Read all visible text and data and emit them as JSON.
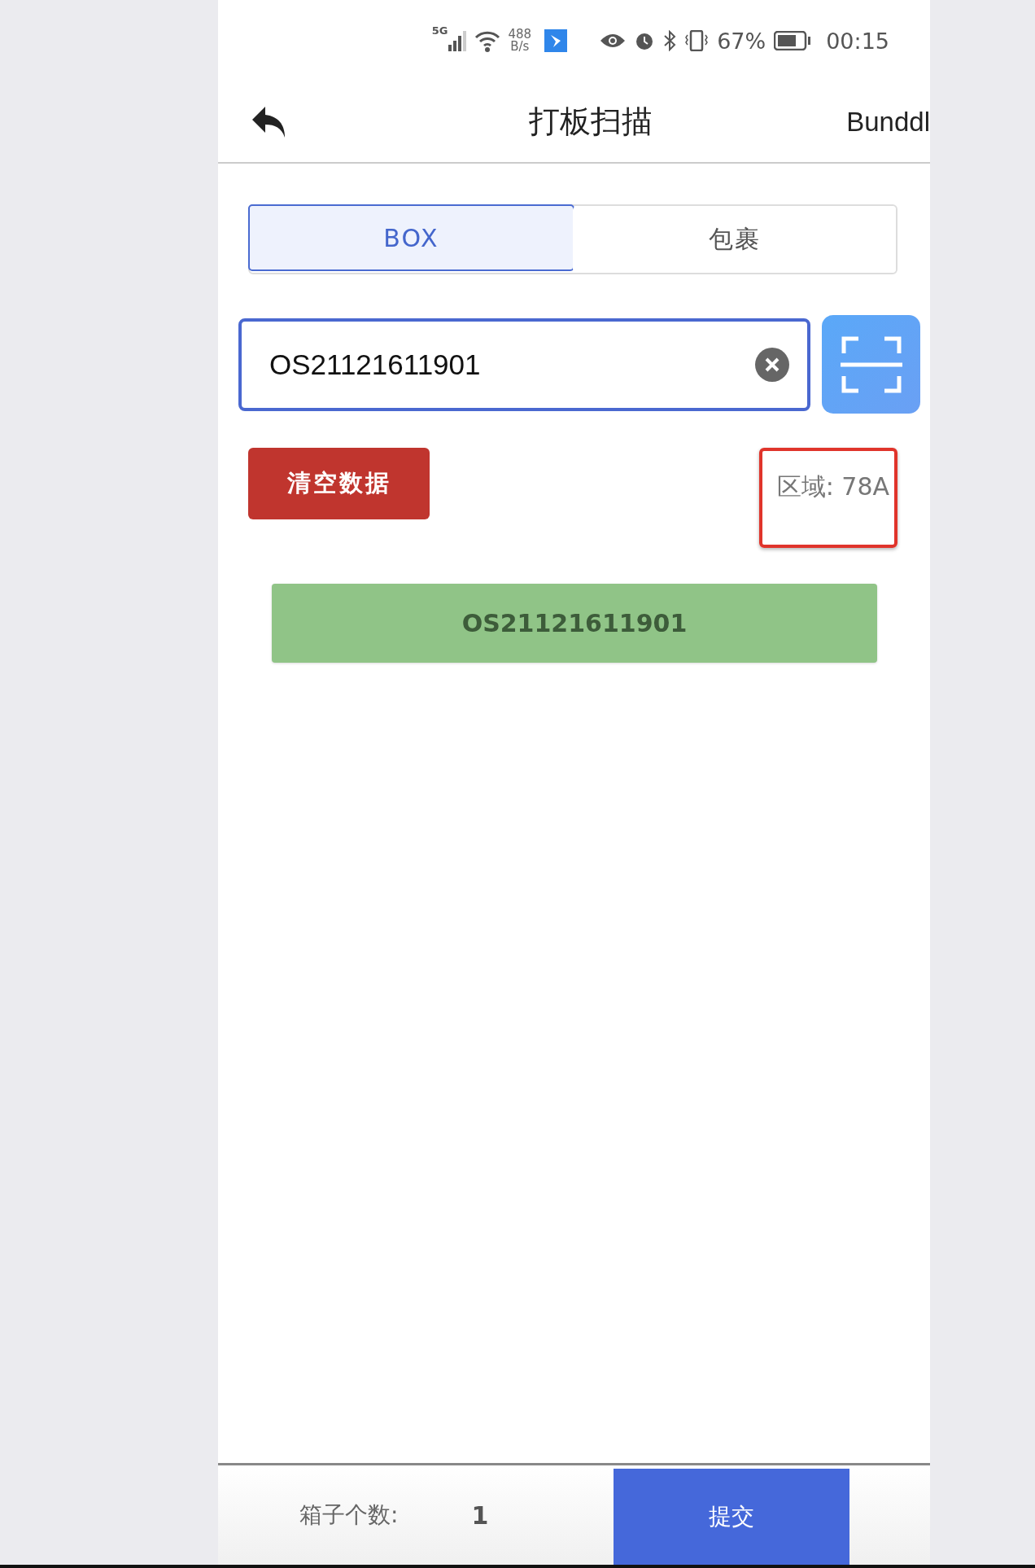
{
  "status_bar": {
    "network_type": "5G",
    "network_speed": "488",
    "network_unit": "B/s",
    "battery": "67%",
    "time": "00:15"
  },
  "header": {
    "title": "打板扫描",
    "action": "Bunddl"
  },
  "tabs": [
    {
      "label": "BOX",
      "selected": true
    },
    {
      "label": "包裹",
      "selected": false
    }
  ],
  "scan_input": {
    "value": "OS21121611901"
  },
  "clear_button": "清空数据",
  "region": {
    "text": "区域: 78A",
    "highlighted": true
  },
  "scanned_items": [
    "OS21121611901"
  ],
  "footer": {
    "count_label": "箱子个数:",
    "count": "1",
    "submit": "提交"
  }
}
